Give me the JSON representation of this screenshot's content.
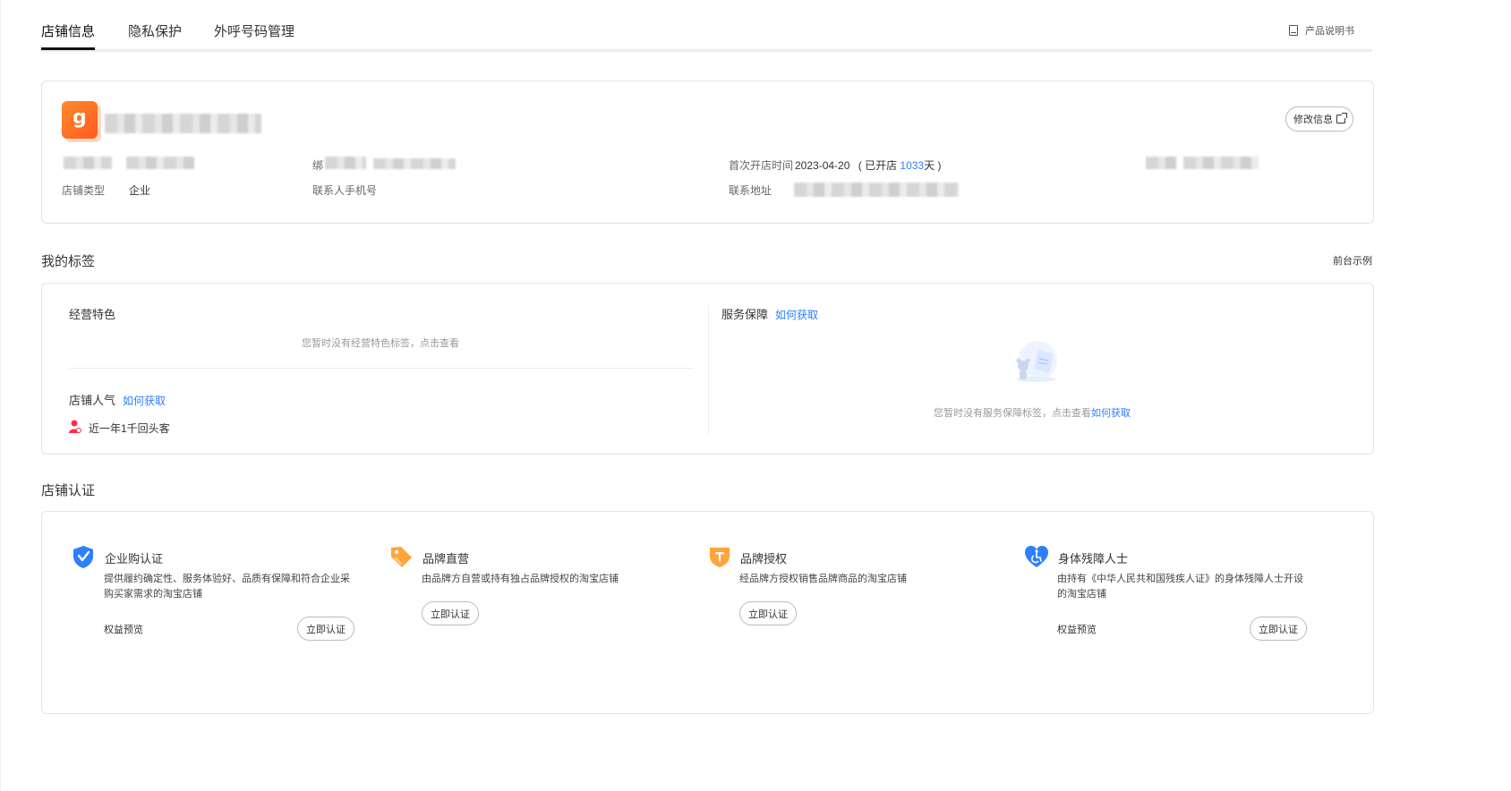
{
  "tabs": [
    {
      "label": "店铺信息",
      "active": true
    },
    {
      "label": "隐私保护",
      "active": false
    },
    {
      "label": "外呼号码管理",
      "active": false
    }
  ],
  "manual_link": "产品说明书",
  "store_info": {
    "logo_char": "g",
    "edit_button": "修改信息",
    "bind_label_partial": "绑",
    "first_open_label": "首次开店时间",
    "first_open_date": "2023-04-20",
    "opened_prefix": "( 已开店 ",
    "opened_days": "1033",
    "opened_suffix": "天 )",
    "store_type_label": "店铺类型",
    "store_type_value": "企业",
    "contact_phone_label": "联系人手机号",
    "contact_address_label": "联系地址"
  },
  "tags_section": {
    "title": "我的标签",
    "front_example": "前台示例",
    "business_feature": {
      "title": "经营特色",
      "empty": "您暂时没有经营特色标签，点击查看"
    },
    "popularity": {
      "title": "店铺人气",
      "link": "如何获取",
      "item": "近一年1千回头客"
    },
    "service": {
      "title": "服务保障",
      "link": "如何获取",
      "empty_text": "您暂时没有服务保障标签，点击查看",
      "empty_link": "如何获取"
    }
  },
  "cert_section": {
    "title": "店铺认证",
    "items": [
      {
        "icon": "shield-check-icon",
        "title": "企业购认证",
        "desc": "提供履约确定性、服务体验好、品质有保障和符合企业采购买家需求的淘宝店铺",
        "benefit": "权益预览",
        "button": "立即认证",
        "color": "#2d7fff"
      },
      {
        "icon": "tag-icon",
        "title": "品牌直营",
        "desc": "由品牌方自营或持有独占品牌授权的淘宝店铺",
        "button": "立即认证",
        "color": "#ffa53a"
      },
      {
        "icon": "badge-icon",
        "title": "品牌授权",
        "desc": "经品牌方授权销售品牌商品的淘宝店铺",
        "button": "立即认证",
        "color": "#ffa53a"
      },
      {
        "icon": "heart-accessibility-icon",
        "title": "身体残障人士",
        "desc": "由持有《中华人民共和国残疾人证》的身体残障人士开设的淘宝店铺",
        "benefit": "权益预览",
        "button": "立即认证",
        "color": "#2d7fff"
      }
    ]
  }
}
